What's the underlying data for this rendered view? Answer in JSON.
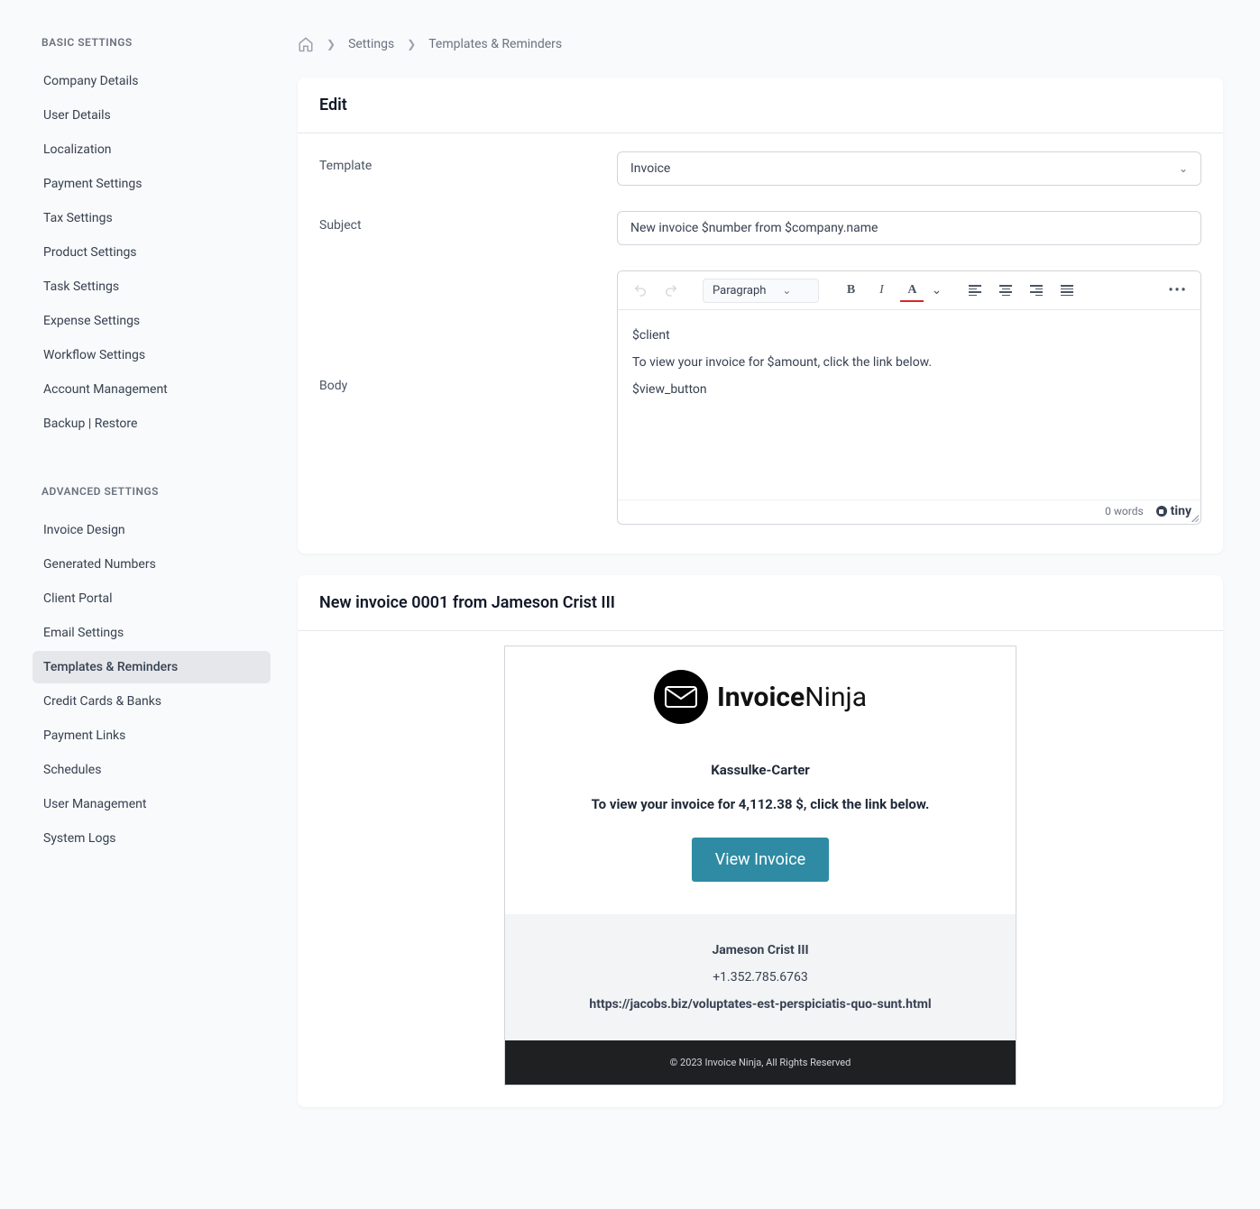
{
  "sidebar": {
    "basic_heading": "BASIC SETTINGS",
    "advanced_heading": "ADVANCED SETTINGS",
    "basic": [
      "Company Details",
      "User Details",
      "Localization",
      "Payment Settings",
      "Tax Settings",
      "Product Settings",
      "Task Settings",
      "Expense Settings",
      "Workflow Settings",
      "Account Management",
      "Backup | Restore"
    ],
    "advanced": [
      "Invoice Design",
      "Generated Numbers",
      "Client Portal",
      "Email Settings",
      "Templates & Reminders",
      "Credit Cards & Banks",
      "Payment Links",
      "Schedules",
      "User Management",
      "System Logs"
    ]
  },
  "breadcrumbs": {
    "item1": "Settings",
    "item2": "Templates & Reminders"
  },
  "edit": {
    "title": "Edit",
    "labels": {
      "template": "Template",
      "subject": "Subject",
      "body": "Body"
    },
    "template_value": "Invoice",
    "subject_value": "New invoice $number from $company.name",
    "toolbar": {
      "format": "Paragraph"
    },
    "body_lines": {
      "l1": "$client",
      "l2": "To view your invoice for $amount, click the link below.",
      "l3": "$view_button"
    },
    "footer": {
      "word_count": "0 words",
      "brand": "tiny"
    }
  },
  "preview": {
    "title": "New invoice 0001 from Jameson Crist III",
    "logo": {
      "part1": "Invoice",
      "part2": "Ninja"
    },
    "client": "Kassulke-Carter",
    "amount_line": "To view your invoice for 4,112.38 $, click the link below.",
    "button": "View Invoice",
    "contact": {
      "name": "Jameson Crist III",
      "phone": "+1.352.785.6763",
      "url": "https://jacobs.biz/voluptates-est-perspiciatis-quo-sunt.html"
    },
    "copyright": "© 2023 Invoice Ninja, All Rights Reserved"
  }
}
